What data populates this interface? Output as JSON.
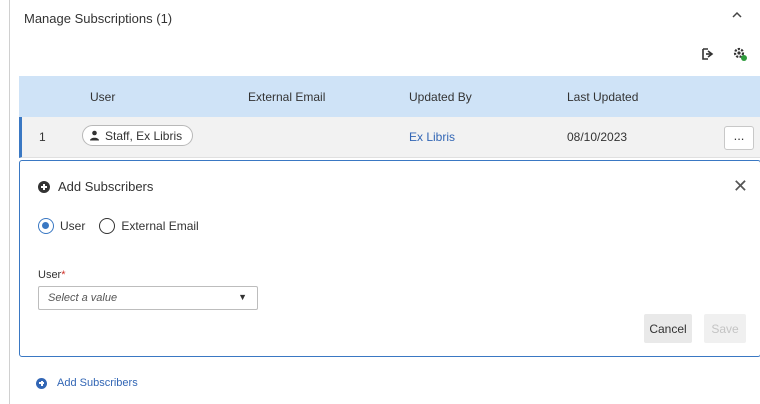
{
  "section": {
    "title": "Manage Subscriptions (1)"
  },
  "table": {
    "columns": [
      "User",
      "External Email",
      "Updated By",
      "Last Updated"
    ],
    "rows": [
      {
        "index": "1",
        "user": "Staff, Ex Libris",
        "external_email": "",
        "updated_by": "Ex Libris",
        "last_updated": "08/10/2023",
        "actions_label": "..."
      }
    ]
  },
  "panel": {
    "title": "Add Subscribers",
    "close_label": "✕",
    "radio_options": [
      "User",
      "External Email"
    ],
    "selected_radio": "User",
    "field_label": "User",
    "required_mark": "*",
    "select_placeholder": "Select a value",
    "select_arrow": "▼",
    "cancel_label": "Cancel",
    "save_label": "Save"
  },
  "footer": {
    "add_label": "Add Subscribers"
  },
  "colors": {
    "accent": "#3a78c3",
    "header_bg": "#cfe3f7",
    "link": "#3266b5"
  }
}
